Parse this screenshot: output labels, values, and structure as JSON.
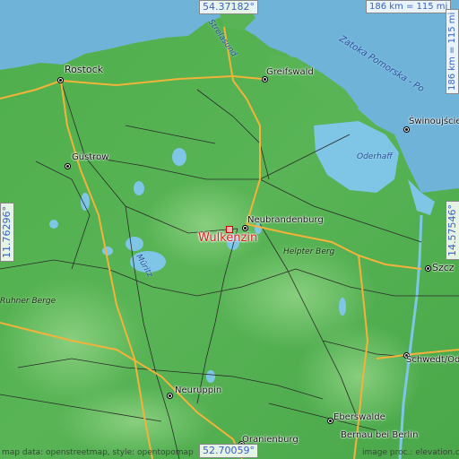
{
  "map": {
    "colors": {
      "sea": "#6fb3d9",
      "lowland": "#4aa84a",
      "upland": "#6cc06a",
      "lake": "#7ec5e6",
      "major_road": "#f3b23a",
      "road": "#2b2b2b",
      "focus": "#e0201e"
    },
    "focus_place": "Wulkenzin",
    "places": {
      "rostock": "Rostock",
      "greifswald": "Greifswald",
      "swinoujscie": "Świnoujście",
      "guestrow": "Güstrow",
      "neubrandenburg": "Neubrandenburg",
      "szczecin": "Szcz",
      "schwedt": "Schwedt/Oder",
      "neuruppin": "Neuruppin",
      "eberswalde": "Eberswalde",
      "oranienburg": "Oranienburg",
      "bernau": "Bernau bei Berlin"
    },
    "water_labels": {
      "strelasund": "Strelasund",
      "zatoka": "Zatoka Pomorska - Po",
      "oderhaff": "Oderhaff",
      "mueritz": "Müritz"
    },
    "peaks": {
      "helpter_berg": "Helpter Berg",
      "ruhner_berge": "Ruhner Berge"
    },
    "coordinates": {
      "top": "54.37182°",
      "bottom": "52.70059°",
      "left": "11.76296°",
      "right": "14.57546°"
    },
    "scale": {
      "top": "186 km = 115 mi",
      "right": "186 km = 115 mi"
    },
    "attribution": {
      "left": "map data: openstreetmap, style: opentopomap",
      "right": "image proc.: elevation.city"
    }
  }
}
